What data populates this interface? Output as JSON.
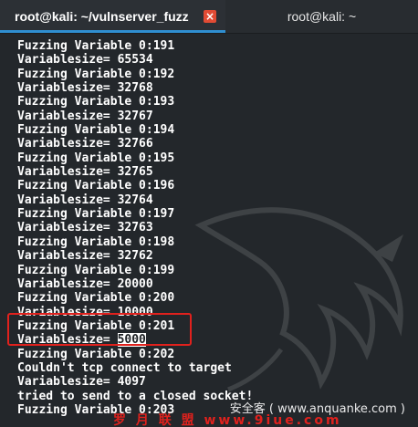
{
  "tabs": [
    {
      "title": "root@kali: ~/vulnserver_fuzz",
      "active": true
    },
    {
      "title": "root@kali: ~",
      "active": false
    }
  ],
  "terminal": {
    "lines": [
      "Fuzzing Variable 0:191",
      "Variablesize= 65534",
      "Fuzzing Variable 0:192",
      "Variablesize= 32768",
      "Fuzzing Variable 0:193",
      "Variablesize= 32767",
      "Fuzzing Variable 0:194",
      "Variablesize= 32766",
      "Fuzzing Variable 0:195",
      "Variablesize= 32765",
      "Fuzzing Variable 0:196",
      "Variablesize= 32764",
      "Fuzzing Variable 0:197",
      "Variablesize= 32763",
      "Fuzzing Variable 0:198",
      "Variablesize= 32762",
      "Fuzzing Variable 0:199",
      "Variablesize= 20000",
      "Fuzzing Variable 0:200",
      "Variablesize= 10000",
      "Fuzzing Variable 0:201",
      "Variablesize= ",
      "Fuzzing Variable 0:202",
      "Couldn't tcp connect to target",
      "Variablesize= 4097",
      "tried to send to a closed socket!",
      "Fuzzing Variable 0:203"
    ],
    "selected_value": "5000"
  },
  "watermarks": {
    "site": "安全客 ( www.anquanke.com )",
    "union": "罗 月 联 盟  www.9iue.com"
  },
  "colors": {
    "accent": "#2f8fd1",
    "highlight": "#e0211d",
    "close": "#e14b34"
  },
  "icons": {
    "close": "close-icon"
  }
}
